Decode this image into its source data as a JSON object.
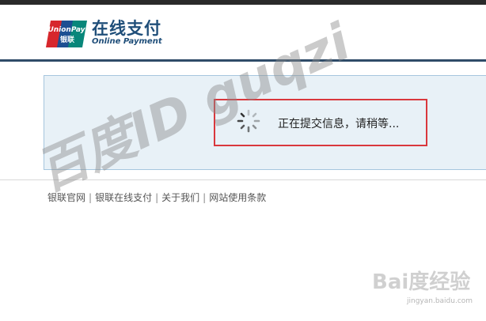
{
  "header": {
    "logo_text_top": "UnionPay",
    "logo_text_bottom": "银联",
    "brand_cn": "在线支付",
    "brand_en": "Online Payment"
  },
  "status": {
    "loading_text": "正在提交信息，请稍等..."
  },
  "footer": {
    "links": [
      "银联官网",
      "银联在线支付",
      "关于我们",
      "网站使用条款"
    ],
    "separator": "|"
  },
  "watermarks": {
    "overlay_text": "百度ID guqzi",
    "baidu_text": "Bai度经验",
    "baidu_url": "jingyan.baidu.com"
  },
  "colors": {
    "brand_blue": "#1f4e79",
    "panel_bg": "#e8f1f7",
    "highlight_red": "#d9383d"
  }
}
